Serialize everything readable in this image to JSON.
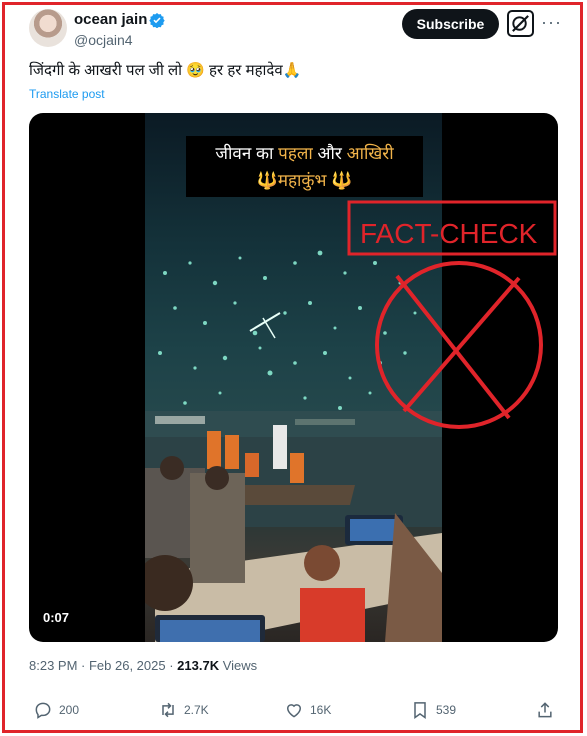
{
  "author": {
    "name": "ocean jain",
    "handle": "@ocjain4"
  },
  "header": {
    "subscribe_label": "Subscribe",
    "more_label": "···"
  },
  "post": {
    "text": "जिंदगी के आखरी पल जी लो 🥹 हर हर महादेव🙏",
    "translate_label": "Translate post"
  },
  "video": {
    "banner_line1_a": "जीवन का ",
    "banner_line1_b": "पहला",
    "banner_line1_c": " और ",
    "banner_line1_d": "आखिरी",
    "banner_line2": "🔱महाकुंभ 🔱",
    "duration": "0:07",
    "overlay_label": "FACT-CHECK"
  },
  "meta": {
    "time": "8:23 PM",
    "separator1": " · ",
    "date": "Feb 26, 2025",
    "separator2": " · ",
    "views_count": "213.7K",
    "views_label": " Views"
  },
  "actions": {
    "replies": "200",
    "reposts": "2.7K",
    "likes": "16K",
    "bookmarks": "539"
  },
  "colors": {
    "accent_red": "#e0242a",
    "link_blue": "#1d9bf0",
    "banner_highlight": "#f2b44a"
  }
}
